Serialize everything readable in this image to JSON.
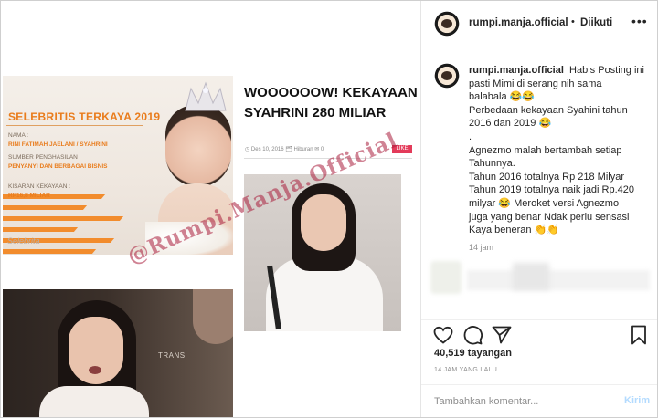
{
  "image": {
    "panel_a": {
      "title": "SELEBRITIS TERKAYA 2019",
      "nama_label": "NAMA :",
      "nama_value": "RINI FATIMAH JAELANI / SYAHRINI",
      "sumber_label": "SUMBER PENGHASILAN :",
      "sumber_value": "PENYANYI DAN BERBAGAI BISNIS",
      "kisaran_label": "KISARAN KEKAYAAN :",
      "kisaran_value": "RP16,8 MILIAR",
      "wm": "Selebrita"
    },
    "panel_b": {
      "logo": "TRANS"
    },
    "article": {
      "headline": "WOOOOOOW! KEKAYAAN SYAHRINI 280 MILIAR",
      "meta": "◷ Des 10, 2016 🗂 Hiburan ✉ 0",
      "tag": "LIKE"
    },
    "watermark": "@Rumpi.Manja.Official"
  },
  "header": {
    "username": "rumpi.manja.official",
    "separator": "•",
    "follow_status": "Diikuti",
    "more_icon": "ellipsis-icon"
  },
  "caption": {
    "username": "rumpi.manja.official",
    "lines": [
      "Habis Posting ini",
      "pasti Mimi di serang nih sama",
      "balabala 😂😂",
      "Perbedaan kekayaan Syahini tahun",
      "2016 dan 2019 😂",
      ".",
      "Agnezmo malah bertambah setiap",
      "Tahunnya.",
      "Tahun 2016 totalnya Rp 218 Milyar",
      "Tahun 2019 totalnya naik jadi Rp.420",
      "milyar 😂 Meroket versi Agnezmo",
      "juga yang benar Ndak perlu sensasi",
      "Kaya beneran 👏👏"
    ],
    "time": "14 jam"
  },
  "actions": {
    "icons": [
      "heart-icon",
      "comment-icon",
      "share-icon",
      "bookmark-icon"
    ],
    "likes": "40,519 tayangan",
    "ago": "14 JAM YANG LALU"
  },
  "comment_box": {
    "placeholder": "Tambahkan komentar...",
    "post_label": "Kirim"
  },
  "colors": {
    "accent_orange": "#f28c2d",
    "post_button_disabled": "#b3dbff",
    "text": "#262626",
    "muted": "#8e8e8e"
  }
}
